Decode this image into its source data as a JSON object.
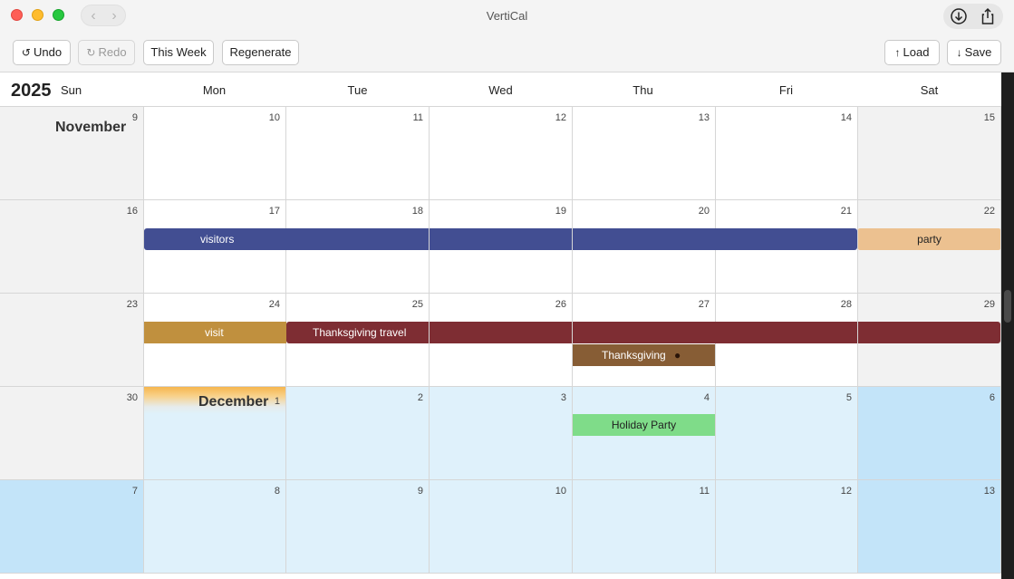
{
  "window": {
    "title": "VertiCal"
  },
  "toolbar": {
    "undo": "Undo",
    "redo": "Redo",
    "this_week": "This Week",
    "regenerate": "Regenerate",
    "load": "Load",
    "save": "Save",
    "undo_icon": "↺",
    "redo_icon": "↻",
    "load_icon": "↑",
    "save_icon": "↓"
  },
  "calendar": {
    "year": "2025",
    "weekdays": [
      "Sun",
      "Mon",
      "Tue",
      "Wed",
      "Thu",
      "Fri",
      "Sat"
    ],
    "weeks": [
      {
        "month_label": "November",
        "days": [
          "9",
          "10",
          "11",
          "12",
          "13",
          "14",
          "15"
        ]
      },
      {
        "month_label": "",
        "days": [
          "16",
          "17",
          "18",
          "19",
          "20",
          "21",
          "22"
        ]
      },
      {
        "month_label": "",
        "days": [
          "23",
          "24",
          "25",
          "26",
          "27",
          "28",
          "29"
        ]
      },
      {
        "month_label": "December",
        "days": [
          "30",
          "1",
          "2",
          "3",
          "4",
          "5",
          "6"
        ]
      },
      {
        "month_label": "",
        "days": [
          "7",
          "8",
          "9",
          "10",
          "11",
          "12",
          "13"
        ]
      }
    ],
    "events": {
      "visitors": "visitors",
      "party": "party",
      "visit": "visit",
      "thanksgiving_travel": "Thanksgiving travel",
      "thanksgiving": "Thanksgiving",
      "thanksgiving_emoji": "●",
      "holiday_party": "Holiday Party"
    },
    "colors": {
      "visitors": "#424e92",
      "party": "#ecc190",
      "visit": "#c0903e",
      "thanksgiving_travel": "#7e2d33",
      "thanksgiving": "#875d35",
      "holiday_party": "#7fdc89",
      "december_bg": "#dff1fb",
      "december_weekend_bg": "#c3e4f9"
    }
  }
}
